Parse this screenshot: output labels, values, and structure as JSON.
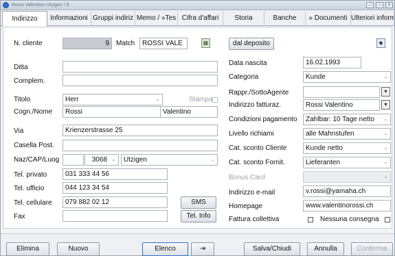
{
  "window": {
    "title": "Rossi Valentino  Utzigen  /  9"
  },
  "tabs": [
    {
      "label": "Indirizzo",
      "active": true
    },
    {
      "label": "Informazioni"
    },
    {
      "label": "Gruppi indiriz"
    },
    {
      "label": "Memo / »Tes"
    },
    {
      "label": "Cifra d'affari"
    },
    {
      "label": "Storia"
    },
    {
      "label": "Banche"
    },
    {
      "label": "» Documenti"
    },
    {
      "label": "Ulteriori inform"
    }
  ],
  "left": {
    "n_cliente_label": "N. cliente",
    "n_cliente_value": "9",
    "match_label": "Match",
    "match_value": "ROSSI VALE",
    "ditta_label": "Ditta",
    "ditta_value": "",
    "complem_label": "Complem.",
    "complem_value": "",
    "titolo_label": "Titolo",
    "titolo_value": "Herr",
    "stampa_label": "Stampa",
    "cognome_label": "Cogn./Nome",
    "cognome_value": "Rossi",
    "nome_value": "Valentino",
    "via_label": "Via",
    "via_value": "Krienzerstrasse 25",
    "casella_label": "Casella Post.",
    "casella_value": "",
    "naz_label": "Naz/CAP/Luog",
    "naz_value": "",
    "cap_value": "3068",
    "luogo_value": "Utzigen",
    "tel_privato_label": "Tel. privato",
    "tel_privato_value": "031 333 44 56",
    "tel_ufficio_label": "Tel. ufficio",
    "tel_ufficio_value": "044 123 34 54",
    "tel_cellulare_label": "Tel. cellulare",
    "tel_cellulare_value": "079 882 02 12",
    "sms_label": "SMS",
    "fax_label": "Fax",
    "fax_value": "",
    "telinfo_label": "Tel. Info"
  },
  "right": {
    "dal_deposito_label": "dal deposito",
    "data_nascita_label": "Data nascita",
    "data_nascita_value": "16.02.1993",
    "categoria_label": "Categoria",
    "categoria_value": "Kunde",
    "rappr_label": "Rappr./SottoAgente",
    "rappr_value": "",
    "indirizzo_fatt_label": "Indirizzo fatturaz.",
    "indirizzo_fatt_value": "Rossi Valentino",
    "condizioni_label": "Condizioni pagamento",
    "condizioni_value": "Zahlbar: 10 Tage netto",
    "livello_label": "Livello richiami",
    "livello_value": "alle Mahnstufen",
    "sconto_cliente_label": "Cat. sconto Cliente",
    "sconto_cliente_value": "Kunde netto",
    "sconto_fornit_label": "Cat. sconto Fornit.",
    "sconto_fornit_value": "Lieferanten",
    "bonus_label": "Bonus Card",
    "bonus_value": "",
    "email_label": "Indirizzo e-mail",
    "email_value": "v.rossi@yamaha.ch",
    "homepage_label": "Homepage",
    "homepage_value": "www.valentinorossi.ch",
    "fattura_label": "Fattura collettiva",
    "nessuna_label": "Nessuna consegna"
  },
  "footer": {
    "elimina": "Elimina",
    "nuovo": "Nuovo",
    "elenco": "Elenco",
    "pin": "⇥",
    "salva": "Salva/Chiudi",
    "annulla": "Annulla",
    "conferma": "Conferma"
  },
  "colors": {
    "accent": "#2f6fd0",
    "gray_field": "#c8ccd2"
  }
}
